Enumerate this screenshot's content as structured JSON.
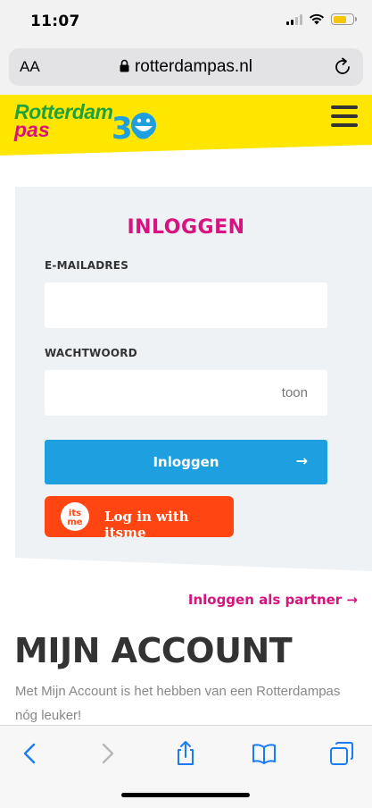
{
  "status_bar": {
    "time": "11:07",
    "battery_level": 0.7,
    "signal_bars": 4,
    "signal_bars_active": 2
  },
  "browser": {
    "text_size_label": "AA",
    "url": "rotterdampas.nl"
  },
  "header": {
    "logo": {
      "line1": "Rotterdam",
      "line2": "pas",
      "anniversary": "30"
    },
    "colors": {
      "background": "#ffe600",
      "green": "#1fa23d",
      "pink": "#d6137e",
      "blue": "#1e9fe0"
    }
  },
  "login": {
    "title": "INLOGGEN",
    "email_label": "E-MAILADRES",
    "email_value": "",
    "password_label": "WACHTWOORD",
    "password_value": "",
    "show_password_label": "toon",
    "submit_label": "Inloggen",
    "submit_arrow": "→",
    "itsme_logo_text": [
      "its",
      "me"
    ],
    "itsme_label": "Log in with itsme"
  },
  "partner_link": "Inloggen als partner →",
  "account": {
    "title": "MIJN ACCOUNT",
    "text": "Met Mijn Account is het hebben van een Rotterdampas nóg leuker!"
  },
  "toolbar": {
    "icons": [
      "back-icon",
      "forward-icon",
      "share-icon",
      "bookmarks-icon",
      "tabs-icon"
    ]
  }
}
